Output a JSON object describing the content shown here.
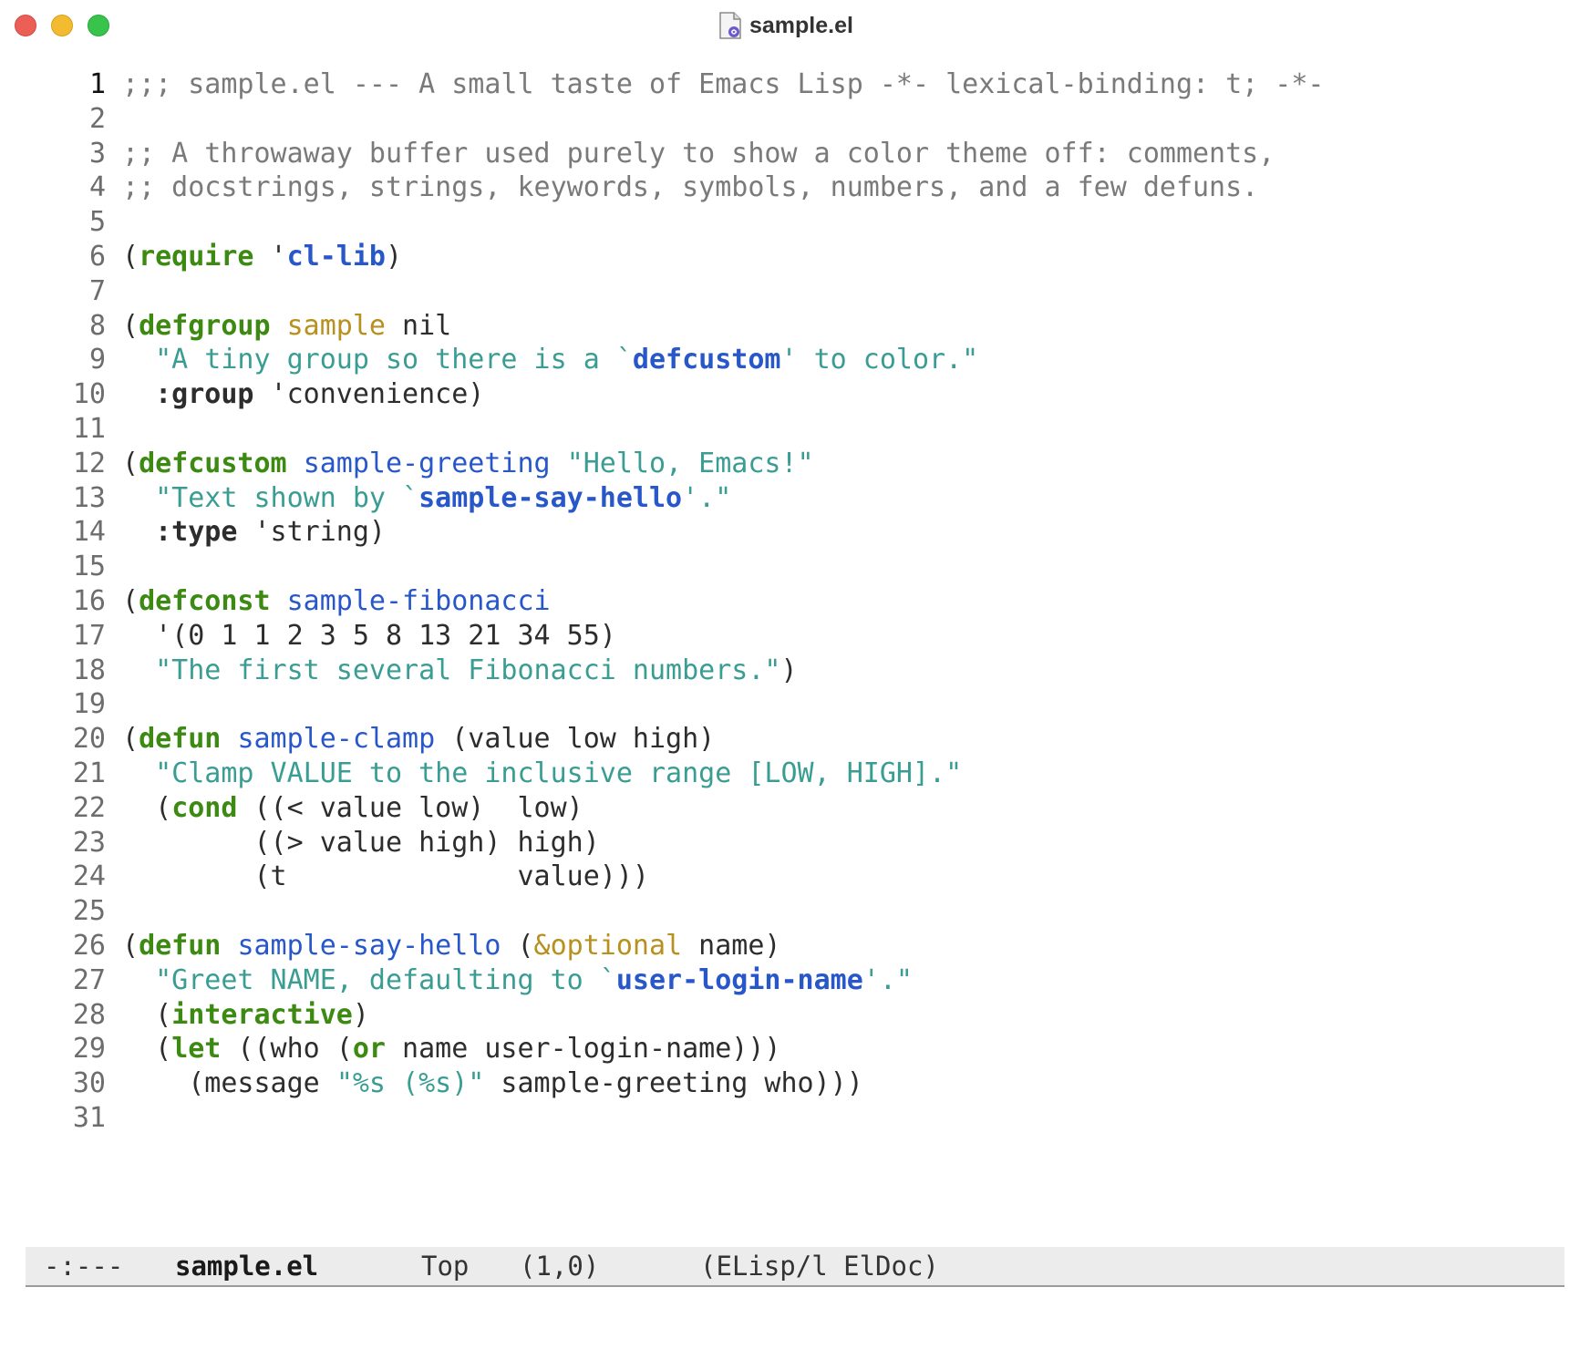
{
  "window": {
    "title": "sample.el",
    "icon": "elisp-file-icon"
  },
  "buffer": {
    "lines": [
      {
        "n": "1",
        "segs": [
          {
            "t": ";;; sample.el --- A small taste of Emacs Lisp -*- lexical-binding: t; -*-",
            "c": "comment"
          }
        ]
      },
      {
        "n": "2",
        "segs": []
      },
      {
        "n": "3",
        "segs": [
          {
            "t": ";; A throwaway buffer used purely to show a color theme off: comments,",
            "c": "comment"
          }
        ]
      },
      {
        "n": "4",
        "segs": [
          {
            "t": ";; docstrings, strings, keywords, symbols, numbers, and a few defuns.",
            "c": "comment"
          }
        ]
      },
      {
        "n": "5",
        "segs": []
      },
      {
        "n": "6",
        "segs": [
          {
            "t": "(",
            "c": ""
          },
          {
            "t": "require",
            "c": "kw"
          },
          {
            "t": " '",
            "c": ""
          },
          {
            "t": "cl-lib",
            "c": "sym"
          },
          {
            "t": ")",
            "c": ""
          }
        ]
      },
      {
        "n": "7",
        "segs": []
      },
      {
        "n": "8",
        "segs": [
          {
            "t": "(",
            "c": ""
          },
          {
            "t": "defgroup",
            "c": "kw"
          },
          {
            "t": " ",
            "c": ""
          },
          {
            "t": "sample",
            "c": "var"
          },
          {
            "t": " nil",
            "c": ""
          }
        ]
      },
      {
        "n": "9",
        "segs": [
          {
            "t": "  ",
            "c": ""
          },
          {
            "t": "\"A tiny group so there is a `",
            "c": "str"
          },
          {
            "t": "defcustom",
            "c": "strsym"
          },
          {
            "t": "' to color.\"",
            "c": "str"
          }
        ]
      },
      {
        "n": "10",
        "segs": [
          {
            "t": "  ",
            "c": ""
          },
          {
            "t": ":group",
            "c": "key"
          },
          {
            "t": " 'convenience)",
            "c": ""
          }
        ]
      },
      {
        "n": "11",
        "segs": []
      },
      {
        "n": "12",
        "segs": [
          {
            "t": "(",
            "c": ""
          },
          {
            "t": "defcustom",
            "c": "kw"
          },
          {
            "t": " ",
            "c": ""
          },
          {
            "t": "sample-greeting",
            "c": "fn"
          },
          {
            "t": " ",
            "c": ""
          },
          {
            "t": "\"Hello, Emacs!\"",
            "c": "str"
          }
        ]
      },
      {
        "n": "13",
        "segs": [
          {
            "t": "  ",
            "c": ""
          },
          {
            "t": "\"Text shown by `",
            "c": "str"
          },
          {
            "t": "sample-say-hello",
            "c": "strsym"
          },
          {
            "t": "'.\"",
            "c": "str"
          }
        ]
      },
      {
        "n": "14",
        "segs": [
          {
            "t": "  ",
            "c": ""
          },
          {
            "t": ":type",
            "c": "key"
          },
          {
            "t": " 'string)",
            "c": ""
          }
        ]
      },
      {
        "n": "15",
        "segs": []
      },
      {
        "n": "16",
        "segs": [
          {
            "t": "(",
            "c": ""
          },
          {
            "t": "defconst",
            "c": "kw"
          },
          {
            "t": " ",
            "c": ""
          },
          {
            "t": "sample-fibonacci",
            "c": "fn"
          }
        ]
      },
      {
        "n": "17",
        "segs": [
          {
            "t": "  '(0 1 1 2 3 5 8 13 21 34 55)",
            "c": ""
          }
        ]
      },
      {
        "n": "18",
        "segs": [
          {
            "t": "  ",
            "c": ""
          },
          {
            "t": "\"The first several Fibonacci numbers.\"",
            "c": "str"
          },
          {
            "t": ")",
            "c": ""
          }
        ]
      },
      {
        "n": "19",
        "segs": []
      },
      {
        "n": "20",
        "segs": [
          {
            "t": "(",
            "c": ""
          },
          {
            "t": "defun",
            "c": "kw"
          },
          {
            "t": " ",
            "c": ""
          },
          {
            "t": "sample-clamp",
            "c": "fn"
          },
          {
            "t": " (value low high)",
            "c": ""
          }
        ]
      },
      {
        "n": "21",
        "segs": [
          {
            "t": "  ",
            "c": ""
          },
          {
            "t": "\"Clamp VALUE to the inclusive range [LOW, HIGH].\"",
            "c": "str"
          }
        ]
      },
      {
        "n": "22",
        "segs": [
          {
            "t": "  (",
            "c": ""
          },
          {
            "t": "cond",
            "c": "kw"
          },
          {
            "t": " ((< value low)  low)",
            "c": ""
          }
        ]
      },
      {
        "n": "23",
        "segs": [
          {
            "t": "        ((> value high) high)",
            "c": ""
          }
        ]
      },
      {
        "n": "24",
        "segs": [
          {
            "t": "        (t              value)))",
            "c": ""
          }
        ]
      },
      {
        "n": "25",
        "segs": []
      },
      {
        "n": "26",
        "segs": [
          {
            "t": "(",
            "c": ""
          },
          {
            "t": "defun",
            "c": "kw"
          },
          {
            "t": " ",
            "c": ""
          },
          {
            "t": "sample-say-hello",
            "c": "fn"
          },
          {
            "t": " (",
            "c": ""
          },
          {
            "t": "&optional",
            "c": "var"
          },
          {
            "t": " name)",
            "c": ""
          }
        ]
      },
      {
        "n": "27",
        "segs": [
          {
            "t": "  ",
            "c": ""
          },
          {
            "t": "\"Greet NAME, defaulting to `",
            "c": "str"
          },
          {
            "t": "user-login-name",
            "c": "strsym"
          },
          {
            "t": "'.\"",
            "c": "str"
          }
        ]
      },
      {
        "n": "28",
        "segs": [
          {
            "t": "  (",
            "c": ""
          },
          {
            "t": "interactive",
            "c": "kw"
          },
          {
            "t": ")",
            "c": ""
          }
        ]
      },
      {
        "n": "29",
        "segs": [
          {
            "t": "  (",
            "c": ""
          },
          {
            "t": "let",
            "c": "kw"
          },
          {
            "t": " ((who (",
            "c": ""
          },
          {
            "t": "or",
            "c": "kw"
          },
          {
            "t": " name user-login-name)))",
            "c": ""
          }
        ]
      },
      {
        "n": "30",
        "segs": [
          {
            "t": "    (message ",
            "c": ""
          },
          {
            "t": "\"%s (%s)\"",
            "c": "str"
          },
          {
            "t": " sample-greeting who)))",
            "c": ""
          }
        ]
      },
      {
        "n": "31",
        "segs": []
      }
    ]
  },
  "modeline": {
    "status": "-:---",
    "buffer_name": "sample.el",
    "position": "Top",
    "line_col": "(1,0)",
    "modes": "(ELisp/l ElDoc)"
  },
  "colors": {
    "comment": "#7a7a7a",
    "keyword": "#3c8a12",
    "function_name": "#2857c9",
    "variable": "#b7901d",
    "string": "#3a9d93",
    "modeline_bg": "#ececec"
  }
}
